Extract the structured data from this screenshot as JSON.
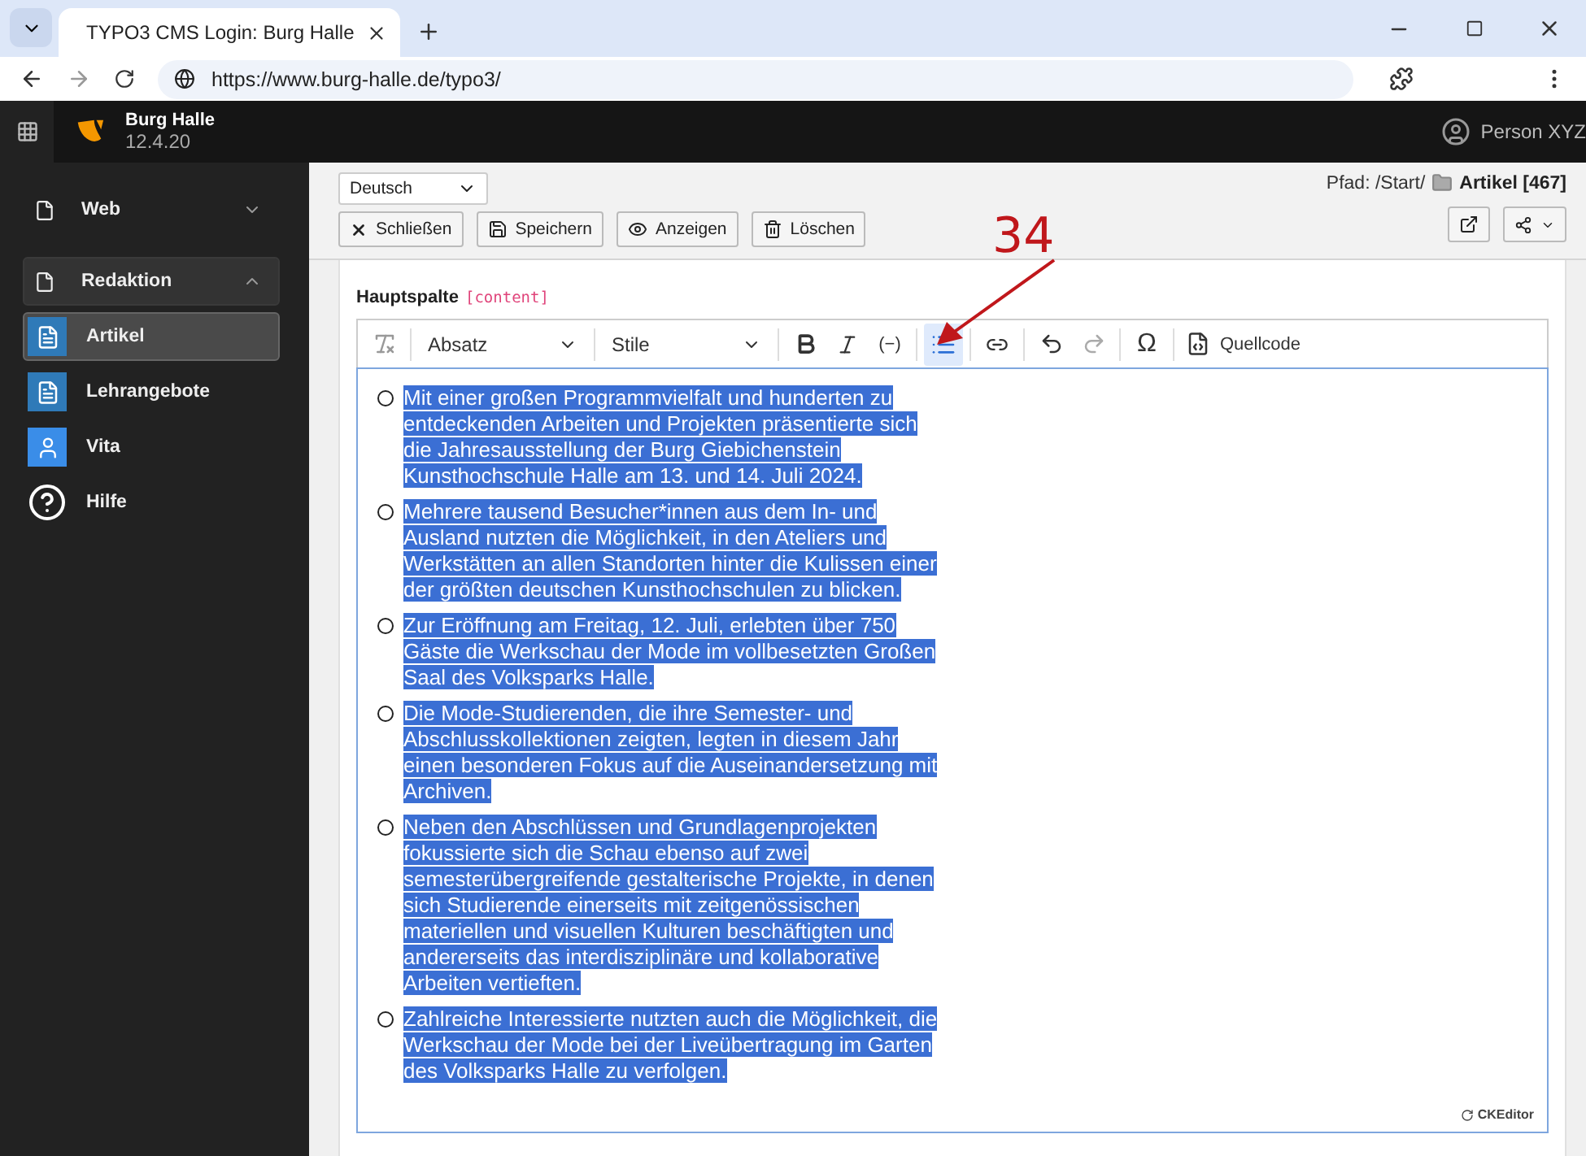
{
  "browser": {
    "tab_title": "TYPO3 CMS Login: Burg Halle",
    "url": "https://www.burg-halle.de/typo3/"
  },
  "topbar": {
    "site_name": "Burg Halle",
    "version": "12.4.20",
    "user": "Person XYZ"
  },
  "sidebar": {
    "items": [
      {
        "label": "Web",
        "kind": "group",
        "expanded": false
      },
      {
        "label": "Redaktion",
        "kind": "group",
        "expanded": true,
        "children": [
          {
            "label": "Artikel",
            "kind": "page",
            "selected": true
          },
          {
            "label": "Lehrangebote",
            "kind": "page",
            "selected": false
          },
          {
            "label": "Vita",
            "kind": "user",
            "selected": false
          }
        ]
      },
      {
        "label": "Hilfe",
        "kind": "help"
      }
    ]
  },
  "docheader": {
    "language": "Deutsch",
    "buttons": [
      {
        "label": "Schließen",
        "kind": "close"
      },
      {
        "label": "Speichern",
        "kind": "save"
      },
      {
        "label": "Anzeigen",
        "kind": "view"
      },
      {
        "label": "Löschen",
        "kind": "delete"
      }
    ],
    "path_label": "Pfad: /Start/",
    "path_page": "Artikel [467]"
  },
  "field": {
    "label": "Hauptspalte",
    "tag": "[content]"
  },
  "toolbar": [
    {
      "kind": "clear-format",
      "selected": false
    },
    {
      "kind": "select",
      "label": "Absatz"
    },
    {
      "kind": "select",
      "label": "Stile"
    },
    {
      "kind": "bold",
      "selected": false
    },
    {
      "kind": "italic",
      "selected": false
    },
    {
      "kind": "shy",
      "label": "(−)",
      "selected": false
    },
    {
      "kind": "bullet-list",
      "selected": true
    },
    {
      "kind": "link",
      "selected": false
    },
    {
      "kind": "undo",
      "selected": false
    },
    {
      "kind": "redo",
      "selected": false
    },
    {
      "kind": "special-char",
      "label": "Ω",
      "selected": false
    },
    {
      "kind": "source",
      "label": "Quellcode",
      "selected": false
    }
  ],
  "editor": {
    "items": [
      "Mit einer großen Programmvielfalt und hunderten zu entdeckenden Arbeiten und Projekten präsentierte sich die Jahresausstellung der Burg Giebichenstein Kunsthochschule Halle am 13. und 14. Juli 2024.",
      "Mehrere tausend Besucher*innen aus dem In- und Ausland nutzten die Möglichkeit, in den Ateliers und Werkstätten an allen Standorten hinter die Kulissen einer der größten deutschen Kunsthochschulen zu blicken.",
      "Zur Eröffnung am Freitag, 12. Juli, erlebten über 750 Gäste die Werkschau der Mode im vollbesetzten Großen Saal des Volksparks Halle.",
      "Die Mode-Studierenden, die ihre Semester- und Abschlusskollektionen zeigten, legten in diesem Jahr einen besonderen Fokus auf die Auseinandersetzung mit Archiven.",
      "Neben den Abschlüssen und Grundlagenprojekten fokussierte sich die Schau ebenso auf zwei semesterübergreifende gestalterische Projekte, in denen sich Studierende einerseits mit zeitgenössischen materiellen und visuellen Kulturen beschäftigten und andererseits das interdisziplinäre und kollaborative Arbeiten vertieften.",
      "Zahlreiche Interessierte nutzten auch die Möglichkeit, die Werkschau der Mode bei der Liveübertragung im Garten des Volksparks Halle zu verfolgen."
    ],
    "selected": true,
    "brand": "CKEditor"
  },
  "annotation": {
    "label": "34"
  }
}
